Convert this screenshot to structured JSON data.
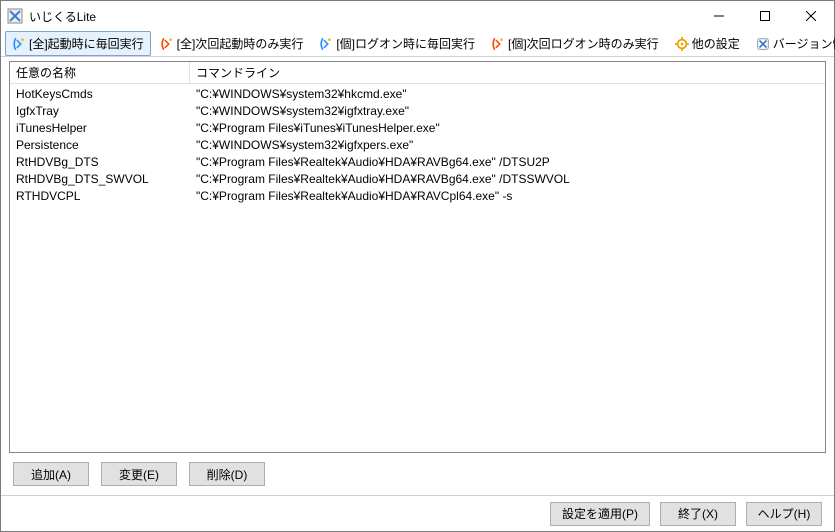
{
  "window": {
    "title": "いじくるLite"
  },
  "tabs": [
    {
      "label": "[全]起動時に毎回実行",
      "active": true,
      "iconColor": "#1e90ff"
    },
    {
      "label": "[全]次回起動時のみ実行",
      "active": false,
      "iconColor": "#ff4500"
    },
    {
      "label": "[個]ログオン時に毎回実行",
      "active": false,
      "iconColor": "#1e90ff"
    },
    {
      "label": "[個]次回ログオン時のみ実行",
      "active": false,
      "iconColor": "#ff4500"
    },
    {
      "label": "他の設定",
      "active": false,
      "iconColor": "#f0a000"
    },
    {
      "label": "バージョン情報",
      "active": false,
      "iconColor": "#3a7bd5"
    }
  ],
  "list": {
    "columns": {
      "name": "任意の名称",
      "cmd": "コマンドライン"
    },
    "rows": [
      {
        "name": "HotKeysCmds",
        "cmd": "\"C:¥WINDOWS¥system32¥hkcmd.exe\""
      },
      {
        "name": "IgfxTray",
        "cmd": "\"C:¥WINDOWS¥system32¥igfxtray.exe\""
      },
      {
        "name": "iTunesHelper",
        "cmd": "\"C:¥Program Files¥iTunes¥iTunesHelper.exe\""
      },
      {
        "name": "Persistence",
        "cmd": "\"C:¥WINDOWS¥system32¥igfxpers.exe\""
      },
      {
        "name": "RtHDVBg_DTS",
        "cmd": "\"C:¥Program Files¥Realtek¥Audio¥HDA¥RAVBg64.exe\" /DTSU2P"
      },
      {
        "name": "RtHDVBg_DTS_SWVOL",
        "cmd": "\"C:¥Program Files¥Realtek¥Audio¥HDA¥RAVBg64.exe\" /DTSSWVOL"
      },
      {
        "name": "RTHDVCPL",
        "cmd": "\"C:¥Program Files¥Realtek¥Audio¥HDA¥RAVCpl64.exe\" -s"
      }
    ]
  },
  "buttons": {
    "add": "追加(A)",
    "edit": "変更(E)",
    "delete": "削除(D)",
    "apply": "設定を適用(P)",
    "exit": "終了(X)",
    "help": "ヘルプ(H)"
  }
}
